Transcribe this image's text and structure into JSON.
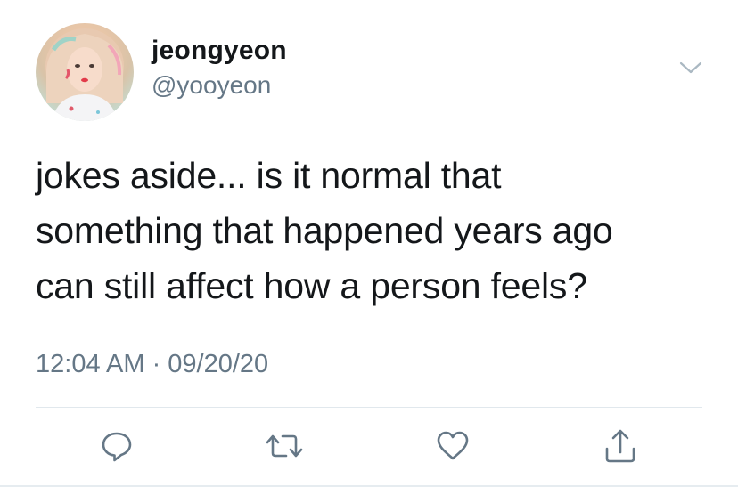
{
  "tweet": {
    "author": {
      "display_name": "jeongyeon",
      "handle": "@yooyeon",
      "avatar_icon": "profile-photo"
    },
    "text_lines": [
      "jokes aside... is it normal that",
      "something that happened years ago",
      "can still affect how a person feels?"
    ],
    "timestamp": "12:04 AM · 09/20/20",
    "menu_icon": "chevron-down-icon",
    "actions": [
      {
        "name": "reply",
        "icon": "reply-icon"
      },
      {
        "name": "retweet",
        "icon": "retweet-icon"
      },
      {
        "name": "like",
        "icon": "heart-icon"
      },
      {
        "name": "share",
        "icon": "share-icon"
      }
    ]
  },
  "colors": {
    "text": "#14171a",
    "secondary": "#657786",
    "divider": "#e1e8ed",
    "icon": "#657786"
  }
}
